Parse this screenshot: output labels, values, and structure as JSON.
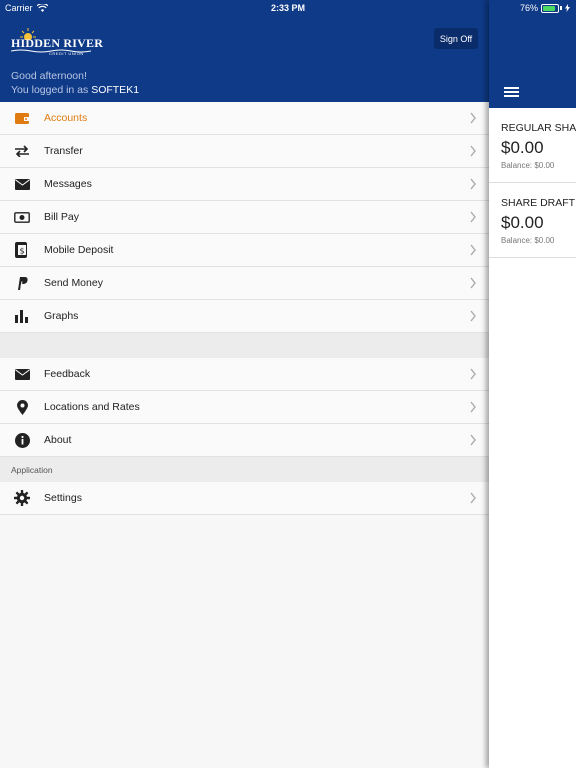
{
  "status_bar": {
    "carrier": "Carrier",
    "time": "2:33 PM",
    "battery": "76%"
  },
  "header": {
    "logo_text": "HIDDEN RIVER",
    "logo_sub": "CREDIT UNION",
    "sign_off_label": "Sign Off",
    "greeting": "Good afternoon!",
    "logged_in_prefix": "You logged in as ",
    "username": "SOFTEK1",
    "bg_color": "#0f3a87",
    "accent_color": "#e07b12"
  },
  "menu": {
    "main_items": [
      {
        "label": "Accounts",
        "icon": "wallet-icon",
        "active": true
      },
      {
        "label": "Transfer",
        "icon": "transfer-arrows-icon"
      },
      {
        "label": "Messages",
        "icon": "envelope-icon"
      },
      {
        "label": "Bill Pay",
        "icon": "money-bill-icon"
      },
      {
        "label": "Mobile Deposit",
        "icon": "mobile-check-icon"
      },
      {
        "label": "Send Money",
        "icon": "paypal-icon"
      },
      {
        "label": "Graphs",
        "icon": "bar-chart-icon"
      }
    ],
    "secondary_items": [
      {
        "label": "Feedback",
        "icon": "envelope-icon"
      },
      {
        "label": "Locations and Rates",
        "icon": "map-pin-icon"
      },
      {
        "label": "About",
        "icon": "info-icon"
      }
    ],
    "application_header": "Application",
    "application_items": [
      {
        "label": "Settings",
        "icon": "gear-icon"
      }
    ]
  },
  "accounts": [
    {
      "name": "REGULAR SHARE",
      "amount": "$0.00",
      "balance": "Balance: $0.00"
    },
    {
      "name": "SHARE DRAFT",
      "amount": "$0.00",
      "balance": "Balance: $0.00"
    }
  ]
}
